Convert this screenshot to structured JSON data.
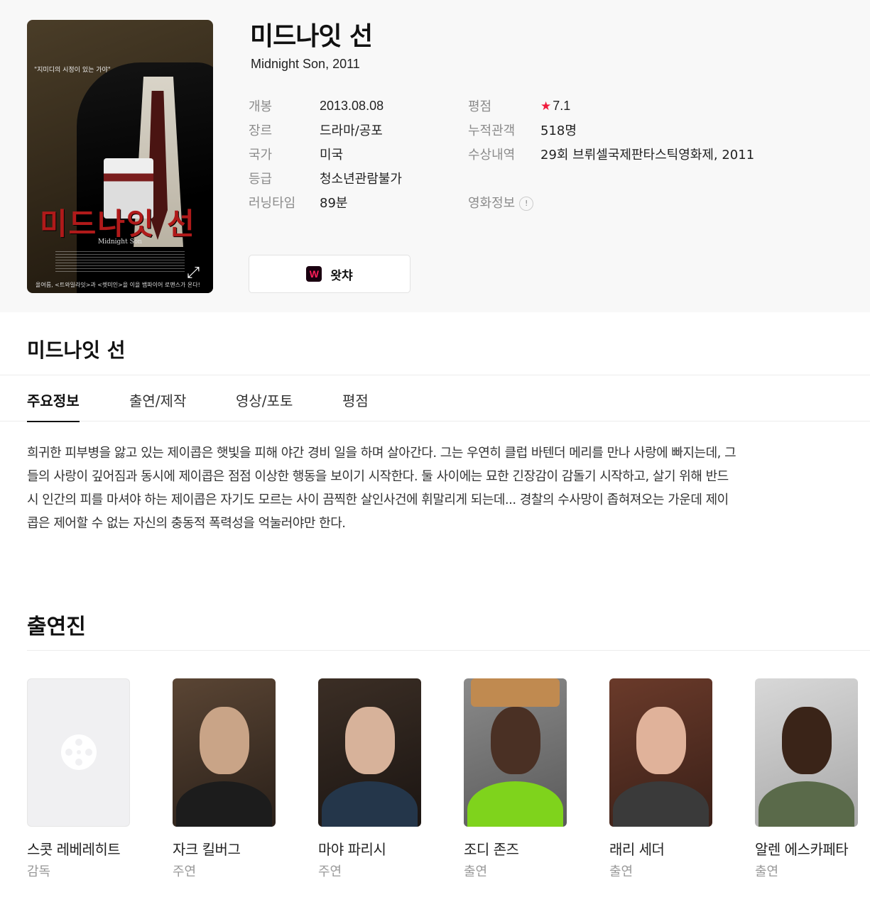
{
  "movie": {
    "title": "미드나잇 선",
    "subtitle": "Midnight Son, 2011",
    "poster": {
      "quote": "\"지미디의 시정이 있는 가야\"",
      "title_text": "미드나잇 선",
      "english_title": "Midnight Son",
      "bottom_line": "올여름, <트와일라잇>과 <렛미인>을 이을 뱀파이어 로맨스가 온다!"
    },
    "info_left": [
      {
        "label": "개봉",
        "value": "2013.08.08"
      },
      {
        "label": "장르",
        "value": "드라마/공포"
      },
      {
        "label": "국가",
        "value": "미국"
      },
      {
        "label": "등급",
        "value": "청소년관람불가"
      },
      {
        "label": "러닝타임",
        "value": "89분"
      }
    ],
    "info_right": [
      {
        "label": "평점",
        "value": "7.1"
      },
      {
        "label": "누적관객",
        "value": "518명"
      },
      {
        "label": "수상내역",
        "value": "29회 브뤼셀국제판타스틱영화제, 2011"
      },
      {
        "label": "영화정보",
        "value": "!"
      }
    ],
    "watcha_button": "왓챠",
    "watcha_logo": "W"
  },
  "section_title": "미드나잇 선",
  "tabs": [
    "주요정보",
    "출연/제작",
    "영상/포토",
    "평점"
  ],
  "synopsis": "희귀한 피부병을 앓고 있는 제이콥은 햇빛을 피해 야간 경비 일을 하며 살아간다. 그는 우연히 클럽 바텐더 메리를 만나 사랑에 빠지는데, 그들의 사랑이 깊어짐과 동시에 제이콥은 점점 이상한 행동을 보이기 시작한다. 둘 사이에는 묘한 긴장감이 감돌기 시작하고, 살기 위해 반드시 인간의 피를 마셔야 하는 제이콥은 자기도 모르는 사이 끔찍한 살인사건에 휘말리게 되는데... 경찰의 수사망이 좁혀져오는 가운데 제이콥은 제어할 수 없는 자신의 충동적 폭력성을 억눌러야만 한다.",
  "cast_title": "출연진",
  "cast": [
    {
      "name": "스콧 레베레히트",
      "role": "감독"
    },
    {
      "name": "자크 킬버그",
      "role": "주연"
    },
    {
      "name": "마야 파리시",
      "role": "주연"
    },
    {
      "name": "조디 존즈",
      "role": "출연"
    },
    {
      "name": "래리 세더",
      "role": "출연"
    },
    {
      "name": "알렌 에스카페타",
      "role": "출연"
    }
  ],
  "colors": {
    "star": "#f01b3c",
    "link": "#2c6fd6"
  }
}
